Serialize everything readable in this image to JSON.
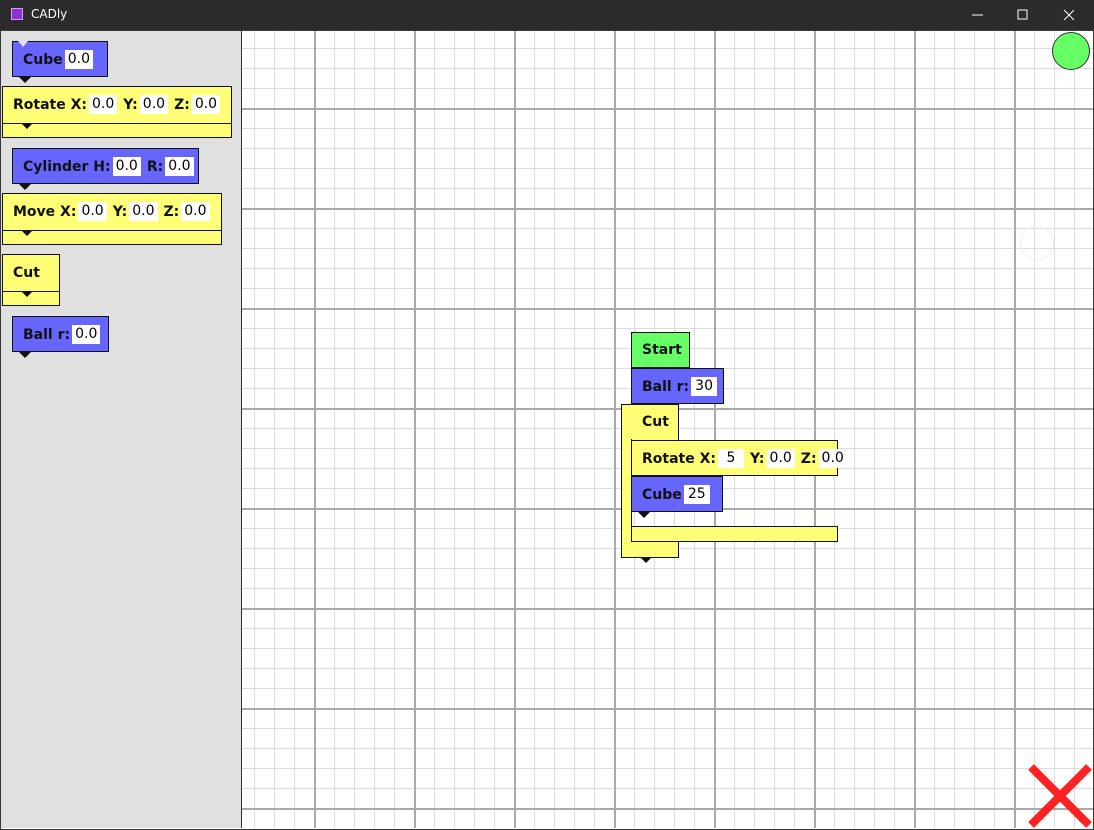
{
  "window": {
    "title": "CADly"
  },
  "palette": {
    "cube": {
      "label": "Cube",
      "value": "0.0"
    },
    "rotate": {
      "label_x": "Rotate X:",
      "x": "0.0",
      "label_y": "Y:",
      "y": "0.0",
      "label_z": "Z:",
      "z": "0.0"
    },
    "cylinder": {
      "label_h": "Cylinder H:",
      "h": "0.0",
      "label_r": "R:",
      "r": "0.0"
    },
    "move": {
      "label_x": "Move X:",
      "x": "0.0",
      "label_y": "Y:",
      "y": "0.0",
      "label_z": "Z:",
      "z": "0.0"
    },
    "cut": {
      "label": "Cut"
    },
    "ball": {
      "label": "Ball r:",
      "value": "0.0"
    }
  },
  "program": {
    "start": {
      "label": "Start"
    },
    "ball": {
      "label": "Ball r:",
      "value": "30"
    },
    "cut": {
      "label": "Cut"
    },
    "rotate": {
      "label_x": "Rotate X:",
      "x": "5",
      "label_y": "Y:",
      "y": "0.0",
      "label_z": "Z:",
      "z": "0.0"
    },
    "cube": {
      "label": "Cube",
      "value": "25"
    }
  },
  "colors": {
    "shape_block": "#6666ff",
    "operation_block": "#ffff77",
    "start_block": "#66ff66",
    "delete": "#ff2222",
    "run": "#66ff66"
  },
  "icons": {
    "run": "green-circle",
    "delete": "red-x-icon"
  }
}
